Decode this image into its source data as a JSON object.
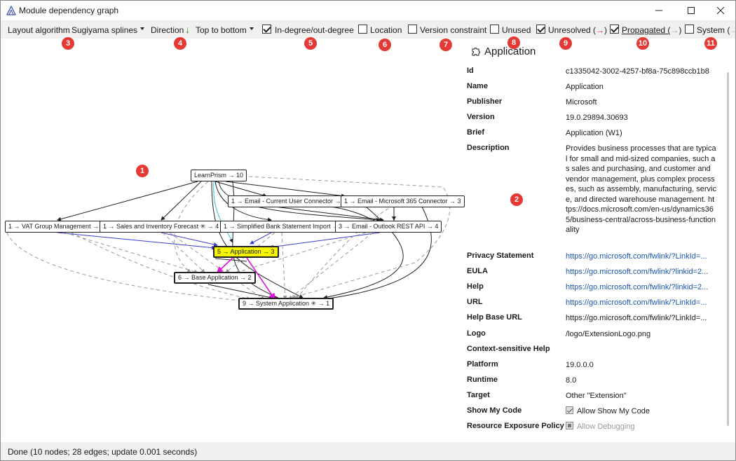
{
  "window": {
    "title": "Module dependency graph"
  },
  "toolbar": {
    "layout_label": "Layout algorithm",
    "layout_value": "Sugiyama splines",
    "direction_label": "Direction",
    "direction_value": "Top to bottom",
    "indegree_label": "In-degree/out-degree",
    "location_label": "Location",
    "version_label": "Version constraint",
    "unused_label": "Unused",
    "unresolved_label": "Unresolved (",
    "unresolved_arrow": "→",
    "propagated_label": "Propagated (",
    "propagated_arrow": "→",
    "system_label": "System (",
    "system_arrow": "→",
    "paren_close": ")"
  },
  "badges": [
    "1",
    "2",
    "3",
    "4",
    "5",
    "6",
    "7",
    "8",
    "9",
    "10",
    "11"
  ],
  "graph": {
    "nodes": [
      "LearnPrism → 10",
      "1 → Email - Current User Connector → 3",
      "1 → Email - Microsoft 365 Connector → 3",
      "1 → VAT Group Management → 4",
      "1 → Sales and Inventory Forecast ✳ → 4",
      "1 → Simplified Bank Statement Import → 4",
      "3 → Email - Outlook REST API → 4",
      "5 → Application → 3",
      "6 → Base Application → 2",
      "9 → System Application ✳ → 1"
    ]
  },
  "panel": {
    "title": "Application",
    "rows": [
      {
        "key": "Id",
        "value": "c1335042-3002-4257-bf8a-75c898ccb1b8"
      },
      {
        "key": "Name",
        "value": "Application"
      },
      {
        "key": "Publisher",
        "value": "Microsoft"
      },
      {
        "key": "Version",
        "value": "19.0.29894.30693"
      },
      {
        "key": "Brief",
        "value": "Application (W1)"
      },
      {
        "key": "Description",
        "value": "Provides business processes that are typical for small and mid-sized companies, such as sales and purchasing, and customer and vendor management, plus complex processes, such as assembly, manufacturing, service, and directed warehouse management. https://docs.microsoft.com/en-us/dynamics365/business-central/across-business-functionality"
      },
      {
        "key": "Privacy Statement",
        "value": "https://go.microsoft.com/fwlink/?LinkId=..."
      },
      {
        "key": "EULA",
        "value": "https://go.microsoft.com/fwlink/?linkid=2..."
      },
      {
        "key": "Help",
        "value": "https://go.microsoft.com/fwlink/?linkid=2..."
      },
      {
        "key": "URL",
        "value": "https://go.microsoft.com/fwlink/?LinkId=..."
      },
      {
        "key": "Help Base URL",
        "value": "https://go.microsoft.com/fwlink/?LinkId=..."
      },
      {
        "key": "Logo",
        "value": "/logo/ExtensionLogo.png"
      },
      {
        "key": "Context-sensitive Help",
        "value": ""
      },
      {
        "key": "Platform",
        "value": "19.0.0.0"
      },
      {
        "key": "Runtime",
        "value": "8.0"
      },
      {
        "key": "Target",
        "value": "Other \"Extension\""
      },
      {
        "key": "Show My Code",
        "value": "Allow Show My Code"
      },
      {
        "key": "Resource Exposure Policy",
        "value": "Allow Debugging"
      }
    ]
  },
  "status": {
    "text": "Done (10 nodes; 28 edges; update 0.001 seconds)"
  }
}
